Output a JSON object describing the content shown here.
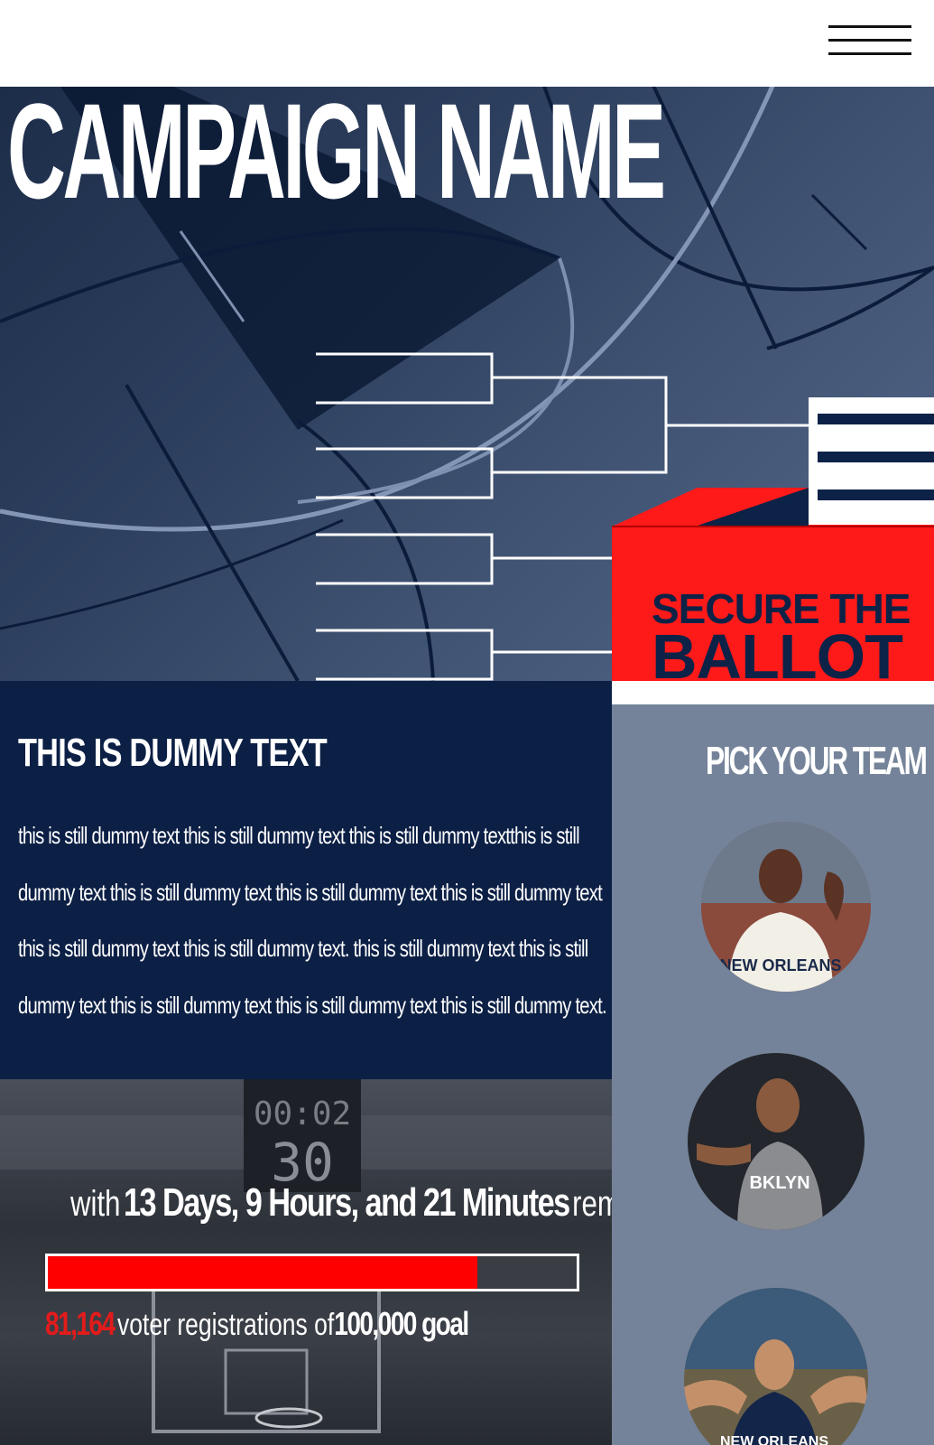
{
  "header": {
    "menu_icon": "hamburger-menu-icon"
  },
  "hero": {
    "campaign_title": "CAMPAIGN NAME",
    "logo": {
      "line1": "SECURE THE",
      "line2": "BALLOT"
    }
  },
  "info": {
    "heading": "THIS IS DUMMY TEXT",
    "body": "this is still dummy text this is still dummy text this is still dummy  textthis is still dummy  text this is still dummy text this is still  dummy text this is still dummy text this is still dummy text this is still dummy text. this is still dummy text this is still dummy text this is still dummy text this is still dummy text this is still dummy text."
  },
  "countdown": {
    "prefix": "with",
    "time_remaining": "13 Days, 9 Hours, and 21 Minutes",
    "suffix": "remaining",
    "progress_fraction": 0.8116,
    "registrations_count": "81,164",
    "registrations_text": "voter registrations of",
    "goal": "100,000 goal"
  },
  "team_panel": {
    "heading": "PICK YOUR TEAM",
    "players": [
      {
        "jersey_text": "NEW ORLEANS",
        "jersey_color": "#f2efe6"
      },
      {
        "jersey_text": "BKLYN",
        "jersey_color": "#8a8c90"
      },
      {
        "jersey_text": "NEW ORLEANS",
        "jersey_color": "#14254a"
      }
    ]
  },
  "colors": {
    "navy": "#0c1f45",
    "accent_red": "#ff0000",
    "panel_gray": "#748399"
  }
}
